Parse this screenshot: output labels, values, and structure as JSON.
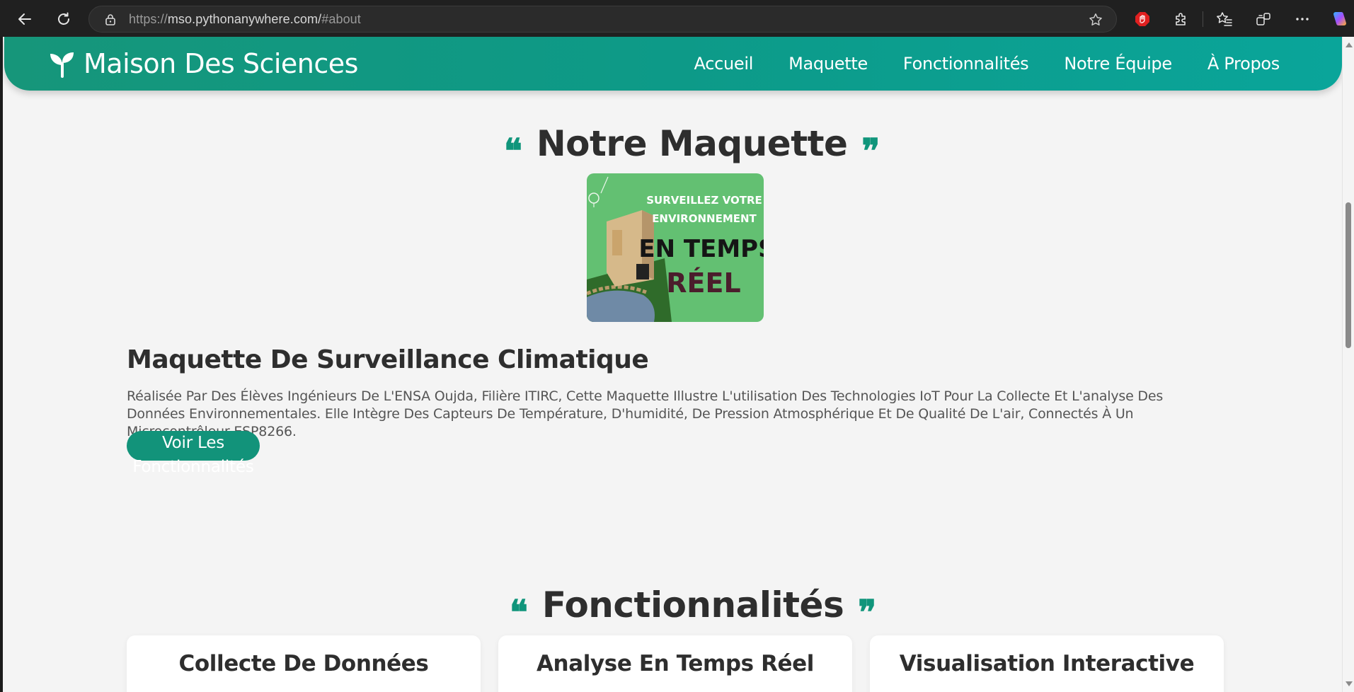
{
  "browser": {
    "url_protocol": "https://",
    "url_host": "mso.pythonanywhere.com/",
    "url_fragment": "#about"
  },
  "header": {
    "brand": "Maison Des Sciences",
    "nav": [
      "Accueil",
      "Maquette",
      "Fonctionnalités",
      "Notre Équipe",
      "À Propos"
    ]
  },
  "maquette_section": {
    "title": "Notre Maquette",
    "poster_lines": [
      "SURVEILLEZ VOTRE",
      "ENVIRONNEMENT",
      "EN TEMPS",
      "RÉEL"
    ],
    "heading": "Maquette De Surveillance Climatique",
    "description": "Réalisée Par Des Élèves Ingénieurs De L'ENSA Oujda, Filière ITIRC, Cette Maquette Illustre L'utilisation Des Technologies IoT Pour La Collecte Et L'analyse Des Données Environnementales. Elle Intègre Des Capteurs De Température, D'humidité, De Pression Atmosphérique Et De Qualité De L'air, Connectés À Un Microcontrôleur ESP8266.",
    "cta_line1": "Voir Les",
    "cta_line2": "Fonctionnalités"
  },
  "features_section": {
    "title": "Fonctionnalités",
    "cards": [
      "Collecte De Données",
      "Analyse En Temps Réel",
      "Visualisation Interactive"
    ]
  },
  "colors": {
    "accent": "#10957b",
    "page_bg": "#f4f4f4",
    "text": "#2e2e2e"
  }
}
